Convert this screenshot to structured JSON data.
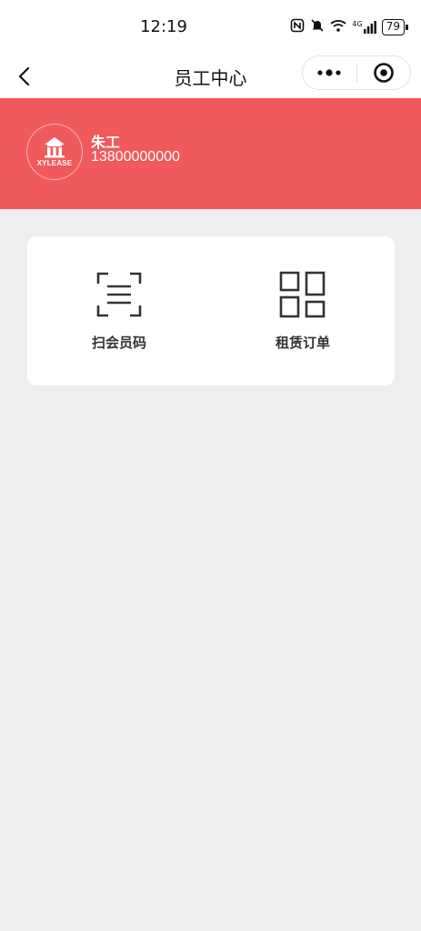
{
  "status_bar": {
    "time": "12:19",
    "icons": [
      "nfc-icon",
      "mute-icon",
      "wifi-icon",
      "signal-4g-icon"
    ],
    "network_label": "4G",
    "battery": "79"
  },
  "nav": {
    "title": "员工中心"
  },
  "user": {
    "name": "朱工",
    "phone": "13800000000",
    "logo_text": "XYLEASE"
  },
  "actions": [
    {
      "label": "扫会员码",
      "icon": "scan-icon"
    },
    {
      "label": "租赁订单",
      "icon": "grid-icon"
    }
  ],
  "colors": {
    "banner": "#f15a5c",
    "background": "#edeef0",
    "card": "#ffffff"
  }
}
